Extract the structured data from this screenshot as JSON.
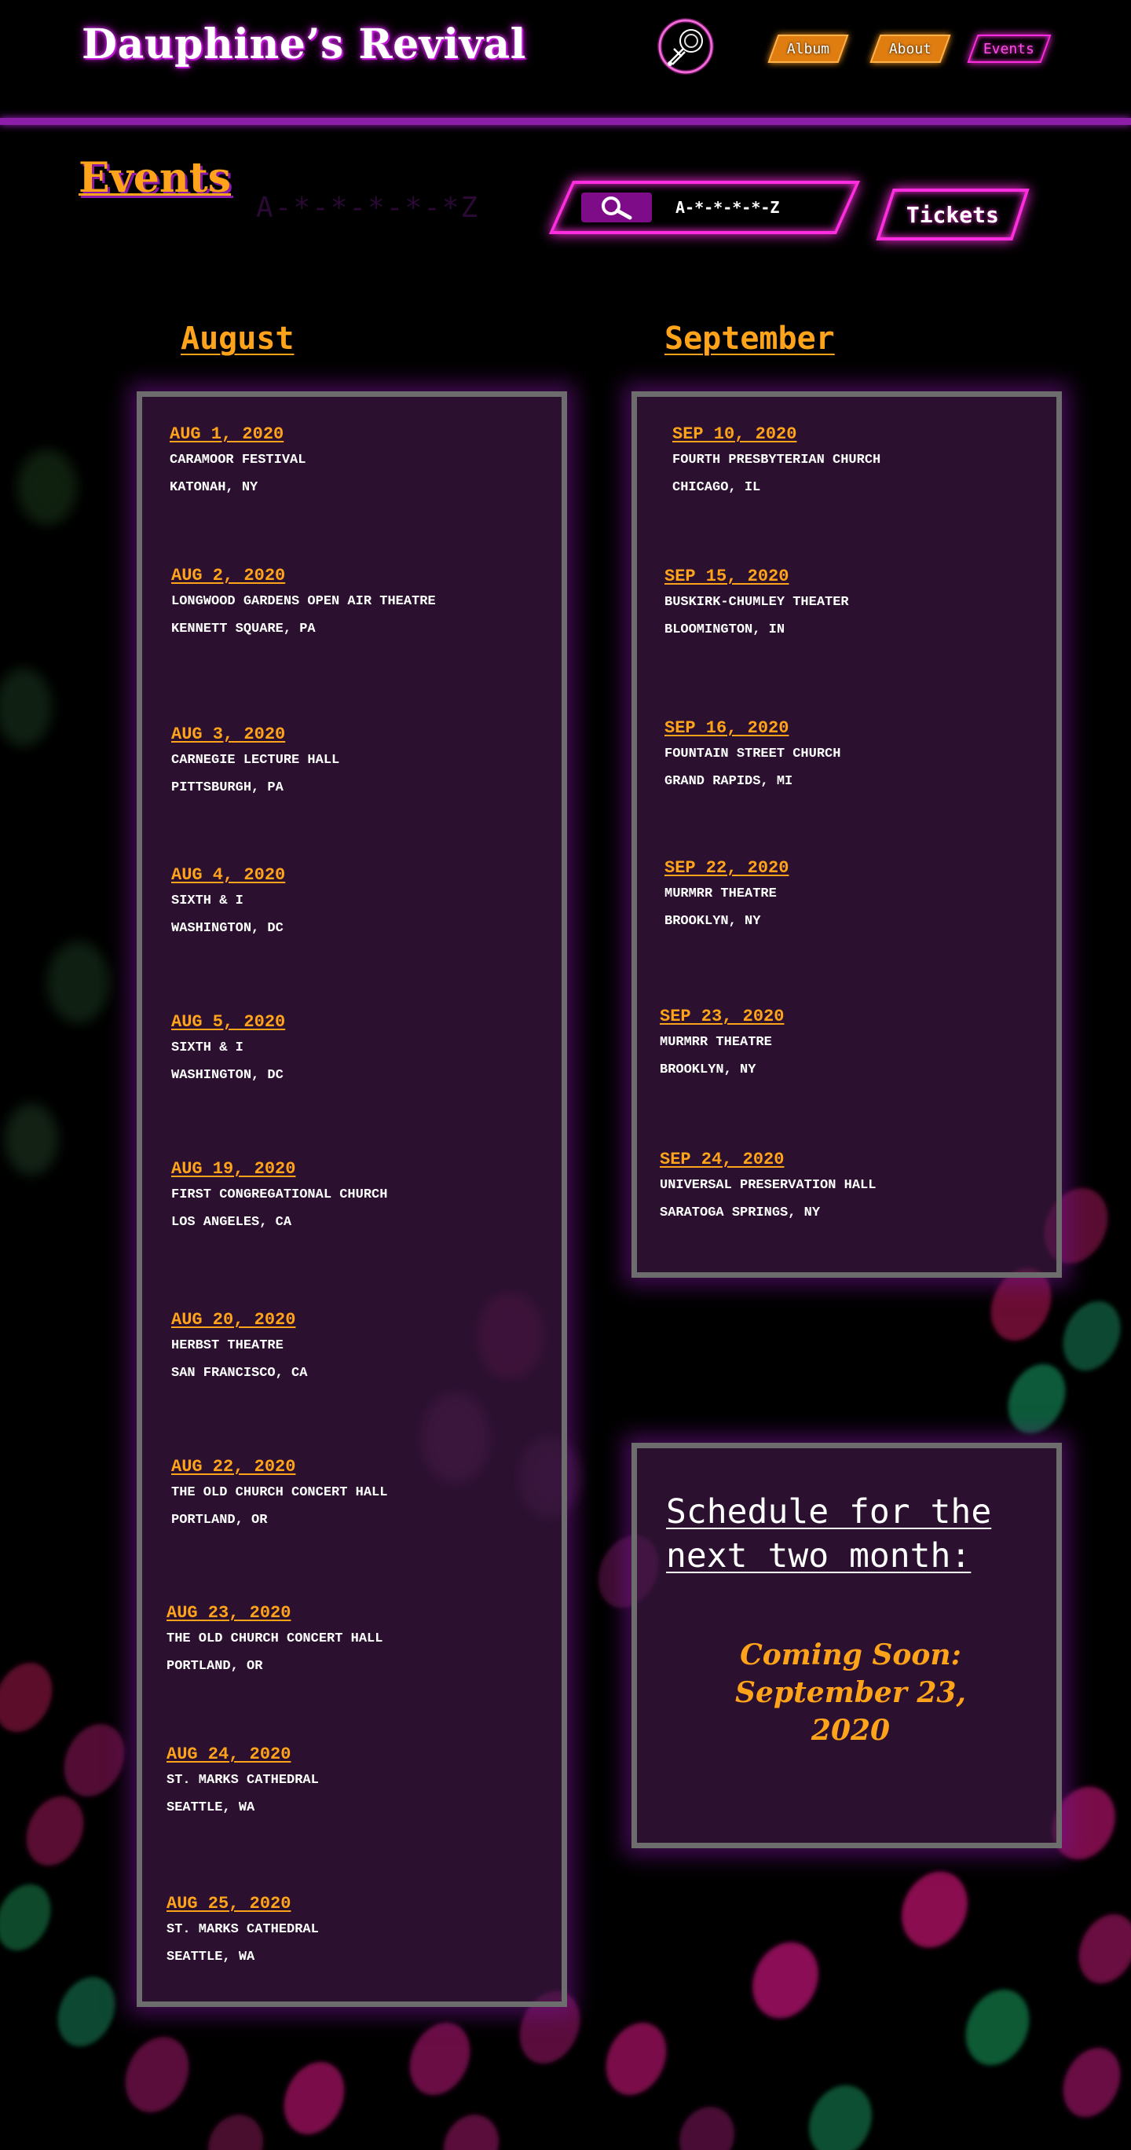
{
  "header": {
    "site_title": "Dauphine’s Revival",
    "logo_icon": "trumpet-icon",
    "nav": [
      {
        "label": "Album"
      },
      {
        "label": "About"
      },
      {
        "label": "Events"
      }
    ]
  },
  "events_page": {
    "heading": "Events",
    "search": {
      "icon": "search-icon",
      "value": "A-*-*-*-*-Z"
    },
    "ghost_text": "A-*-*-*-*-*Z",
    "tickets_label": "Tickets"
  },
  "august": {
    "heading": "August",
    "events": [
      {
        "date": "AUG 1, 2020",
        "venue": "CARAMOOR FESTIVAL",
        "location": "KATONAH, NY"
      },
      {
        "date": "AUG 2, 2020",
        "venue": "LONGWOOD GARDENS OPEN AIR THEATRE",
        "location": "KENNETT SQUARE, PA"
      },
      {
        "date": "AUG 3, 2020",
        "venue": "CARNEGIE LECTURE HALL",
        "location": "PITTSBURGH, PA"
      },
      {
        "date": "AUG 4, 2020",
        "venue": "SIXTH & I",
        "location": "WASHINGTON, DC"
      },
      {
        "date": "AUG 5, 2020",
        "venue": "SIXTH & I",
        "location": "WASHINGTON, DC"
      },
      {
        "date": "AUG 19, 2020",
        "venue": "FIRST CONGREGATIONAL CHURCH",
        "location": "LOS ANGELES, CA"
      },
      {
        "date": "AUG 20, 2020",
        "venue": "HERBST THEATRE",
        "location": "SAN FRANCISCO, CA"
      },
      {
        "date": "AUG 22, 2020",
        "venue": "THE OLD CHURCH CONCERT HALL",
        "location": "PORTLAND, OR"
      },
      {
        "date": "AUG 23, 2020",
        "venue": "THE OLD CHURCH CONCERT HALL",
        "location": "PORTLAND, OR"
      },
      {
        "date": "AUG 24, 2020",
        "venue": "ST. MARKS CATHEDRAL",
        "location": "SEATTLE, WA"
      },
      {
        "date": "AUG 25, 2020",
        "venue": "ST. MARKS CATHEDRAL",
        "location": "SEATTLE, WA"
      }
    ]
  },
  "september": {
    "heading": "September",
    "events": [
      {
        "date": "SEP 10, 2020",
        "venue": "FOURTH PRESBYTERIAN CHURCH",
        "location": "CHICAGO, IL"
      },
      {
        "date": "SEP 15, 2020",
        "venue": "BUSKIRK-CHUMLEY THEATER",
        "location": "BLOOMINGTON, IN"
      },
      {
        "date": "SEP 16, 2020",
        "venue": "FOUNTAIN STREET CHURCH",
        "location": "GRAND RAPIDS, MI"
      },
      {
        "date": "SEP 22, 2020",
        "venue": "MURMRR THEATRE",
        "location": "BROOKLYN, NY"
      },
      {
        "date": "SEP 23, 2020",
        "venue": "MURMRR THEATRE",
        "location": "BROOKLYN, NY"
      },
      {
        "date": "SEP 24, 2020",
        "venue": "UNIVERSAL PRESERVATION HALL",
        "location": "SARATOGA SPRINGS, NY"
      }
    ]
  },
  "schedule": {
    "title": "Schedule for the next two month:",
    "coming_soon_line1": "Coming Soon:",
    "coming_soon_line2": "September 23,",
    "coming_soon_line3": "2020"
  },
  "colors": {
    "accent_orange": "#ffa41a",
    "neon_pink": "#ff2de0",
    "purple": "#8d1ea8",
    "panel_border": "#6d6d6d",
    "background": "#000000"
  }
}
